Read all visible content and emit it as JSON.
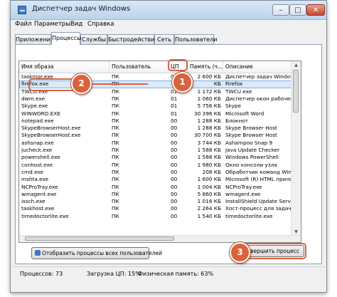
{
  "window": {
    "title": "Диспетчер задач Windows"
  },
  "titlebar_buttons": {
    "minimize": "–",
    "maximize": "□",
    "close": "✕"
  },
  "menu": [
    "Файл",
    "Параметры",
    "Вид",
    "Справка"
  ],
  "tabs": [
    "Приложения",
    "Процессы",
    "Службы",
    "Быстродействие",
    "Сеть",
    "Пользователи"
  ],
  "active_tab": "Процессы",
  "columns": [
    "Имя образа",
    "Пользователь",
    "ЦП",
    "Память (ч...",
    "Описание"
  ],
  "rows": [
    [
      "taskmgr.exe",
      "ПК",
      "01",
      "2 600 КБ",
      "Диспетчер задач Windows"
    ],
    [
      "firefox.exe",
      "ПК",
      "",
      "КБ",
      "Firefox"
    ],
    [
      "TWCU.exe",
      "ПК",
      "01",
      "1 172 КБ",
      "TWCU.exe"
    ],
    [
      "dwm.exe",
      "ПК",
      "01",
      "1 060 КБ",
      "Диспетчер окон рабочего стола"
    ],
    [
      "Skype.exe",
      "ПК",
      "01",
      "5 756 КБ",
      "Skype"
    ],
    [
      "WINWORD.EXE",
      "ПК",
      "01",
      "30 396 КБ",
      "Microsoft Word"
    ],
    [
      "notepad.exe",
      "ПК",
      "00",
      "1 288 КБ",
      "Блокнот"
    ],
    [
      "SkypeBrowserHost.exe",
      "ПК",
      "00",
      "1 288 КБ",
      "Skype Browser Host"
    ],
    [
      "SkypeBrowserHost.exe",
      "ПК",
      "00",
      "30 700 КБ",
      "Skype Browser Host"
    ],
    [
      "ashsnap.exe",
      "ПК",
      "00",
      "3 744 КБ",
      "Ashampoo Snap 9"
    ],
    [
      "jucheck.exe",
      "ПК",
      "00",
      "1 588 КБ",
      "Java Update Checker"
    ],
    [
      "powershell.exe",
      "ПК",
      "00",
      "1 588 КБ",
      "Windows PowerShell"
    ],
    [
      "conhost.exe",
      "ПК",
      "00",
      "1 980 КБ",
      "Окно консоли узла"
    ],
    [
      "cmd.exe",
      "ПК",
      "00",
      "208 КБ",
      "Обработчик команд Windows"
    ],
    [
      "mshta.exe",
      "ПК",
      "00",
      "1 600 КБ",
      "Microsoft (R) HTML приложение"
    ],
    [
      "NCProTray.exe",
      "ПК",
      "00",
      "1 004 КБ",
      "NCProTray.exe"
    ],
    [
      "wmagent.exe",
      "ПК",
      "00",
      "5 860 КБ",
      "wmagent.exe"
    ],
    [
      "issch.exe",
      "ПК",
      "00",
      "1 016 КБ",
      "InstallShield Update Service Sche"
    ],
    [
      "taskhost.exe",
      "ПК",
      "00",
      "2 264 КБ",
      "Хост-процесс для задач Windows"
    ],
    [
      "timedoctorlite.exe",
      "ПК",
      "00",
      "1 540 КБ",
      "timedoctorlite.exe"
    ]
  ],
  "selected_row": "firefox.exe",
  "buttons": {
    "show_all": "Отобразить процессы всех пользователей",
    "end_process": "Завершить процесс"
  },
  "status": {
    "processes": "Процессов: 73",
    "cpu": "Загрузка ЦП: 15%",
    "memory": "Физическая память: 63%"
  },
  "callouts": [
    "1",
    "2",
    "3"
  ],
  "colors": {
    "callout": "#d8633d",
    "selection": "#dbe9f9"
  }
}
